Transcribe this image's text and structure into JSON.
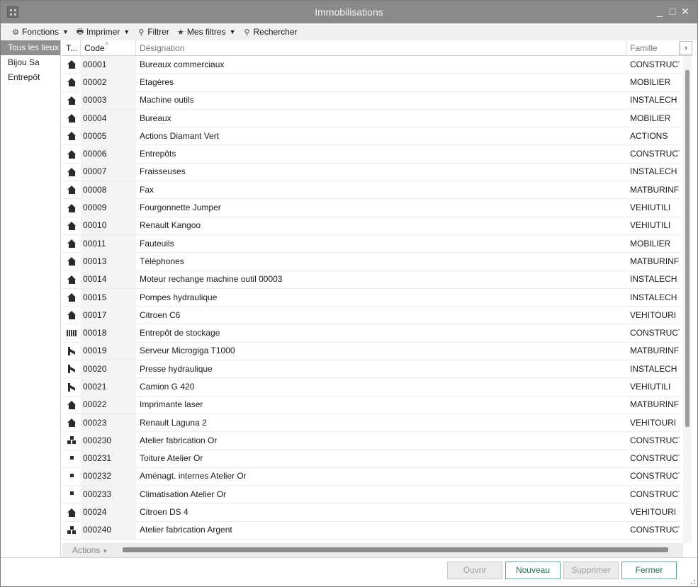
{
  "window": {
    "title": "Immobilisations",
    "controls": {
      "minimize": "_",
      "maximize": "□",
      "close": "✕"
    }
  },
  "toolbar": {
    "items": [
      {
        "label": "Fonctions",
        "icon": "gear-icon",
        "glyph": "⚙",
        "has_caret": true
      },
      {
        "label": "Imprimer",
        "icon": "printer-icon",
        "glyph": "🖶",
        "has_caret": true
      },
      {
        "label": "Filtrer",
        "icon": "search-icon",
        "glyph": "⚲",
        "has_caret": false
      },
      {
        "label": "Mes filtres",
        "icon": "star-icon",
        "glyph": "★",
        "has_caret": true
      },
      {
        "label": "Rechercher",
        "icon": "search-icon",
        "glyph": "⚲",
        "has_caret": false
      }
    ]
  },
  "sidebar": {
    "items": [
      {
        "label": "Tous les lieux",
        "selected": true
      },
      {
        "label": "Bijou Sa",
        "selected": false
      },
      {
        "label": "Entrepôt",
        "selected": false
      }
    ]
  },
  "grid": {
    "columns": {
      "type": "T...",
      "code": "Code",
      "designation": "Désignation",
      "famille": "Famille"
    },
    "sort_indicator": "˄",
    "scroll_right": "›",
    "rows": [
      {
        "icon": "house-icon",
        "code": "00001",
        "designation": "Bureaux commerciaux",
        "famille": "CONSTRUCT"
      },
      {
        "icon": "house-icon",
        "code": "00002",
        "designation": "Etagères",
        "famille": "MOBILIER"
      },
      {
        "icon": "house-icon",
        "code": "00003",
        "designation": "Machine outils",
        "famille": "INSTALECH"
      },
      {
        "icon": "house-icon",
        "code": "00004",
        "designation": "Bureaux",
        "famille": "MOBILIER"
      },
      {
        "icon": "house-icon",
        "code": "00005",
        "designation": "Actions Diamant Vert",
        "famille": "ACTIONS"
      },
      {
        "icon": "house-icon",
        "code": "00006",
        "designation": "Entrepôts",
        "famille": "CONSTRUCT"
      },
      {
        "icon": "house-icon",
        "code": "00007",
        "designation": "Fraisseuses",
        "famille": "INSTALECH"
      },
      {
        "icon": "house-icon",
        "code": "00008",
        "designation": "Fax",
        "famille": "MATBURINF"
      },
      {
        "icon": "house-icon",
        "code": "00009",
        "designation": "Fourgonnette Jumper",
        "famille": "VEHIUTILI"
      },
      {
        "icon": "house-icon",
        "code": "00010",
        "designation": "Renault Kangoo",
        "famille": "VEHIUTILI"
      },
      {
        "icon": "house-icon",
        "code": "00011",
        "designation": "Fauteuils",
        "famille": "MOBILIER"
      },
      {
        "icon": "house-icon",
        "code": "00013",
        "designation": "Téléphones",
        "famille": "MATBURINF"
      },
      {
        "icon": "house-icon",
        "code": "00014",
        "designation": "Moteur rechange machine outil 00003",
        "famille": "INSTALECH"
      },
      {
        "icon": "house-icon",
        "code": "00015",
        "designation": "Pompes hydraulique",
        "famille": "INSTALECH"
      },
      {
        "icon": "house-icon",
        "code": "00017",
        "designation": "Citroen C6",
        "famille": "VEHITOURI"
      },
      {
        "icon": "bars-icon",
        "code": "00018",
        "designation": "Entrepôt de stockage",
        "famille": "CONSTRUCT"
      },
      {
        "icon": "tool-icon",
        "code": "00019",
        "designation": "Serveur  Microgiga T1000",
        "famille": "MATBURINF"
      },
      {
        "icon": "tool-icon",
        "code": "00020",
        "designation": "Presse hydraulique",
        "famille": "INSTALECH"
      },
      {
        "icon": "tool-icon",
        "code": "00021",
        "designation": "Camion G 420",
        "famille": "VEHIUTILI"
      },
      {
        "icon": "house-icon",
        "code": "00022",
        "designation": "Imprimante laser",
        "famille": "MATBURINF"
      },
      {
        "icon": "house-icon",
        "code": "00023",
        "designation": "Renault Laguna 2",
        "famille": "VEHITOURI"
      },
      {
        "icon": "tree-icon",
        "code": "000230",
        "designation": "Atelier fabrication Or",
        "famille": "CONSTRUCT"
      },
      {
        "icon": "dot-icon",
        "code": "000231",
        "designation": "Toiture Atelier Or",
        "famille": "CONSTRUCT"
      },
      {
        "icon": "dot-icon",
        "code": "000232",
        "designation": "Aménagt. internes Atelier Or",
        "famille": "CONSTRUCT"
      },
      {
        "icon": "dot-icon",
        "code": "000233",
        "designation": "Climatisation Atelier Or",
        "famille": "CONSTRUCT"
      },
      {
        "icon": "house-icon",
        "code": "00024",
        "designation": "Citroen DS 4",
        "famille": "VEHITOURI"
      },
      {
        "icon": "tree-icon",
        "code": "000240",
        "designation": "Atelier fabrication Argent",
        "famille": "CONSTRUCT"
      }
    ]
  },
  "footer": {
    "actions_label": "Actions"
  },
  "buttons": {
    "ouvrir": "Ouvrir",
    "nouveau": "Nouveau",
    "supprimer": "Supprimer",
    "fermer": "Fermer"
  },
  "colors": {
    "titlebar": "#8a8a8a",
    "selection": "#8f8f8f",
    "accent_button": "#1f6f55"
  }
}
